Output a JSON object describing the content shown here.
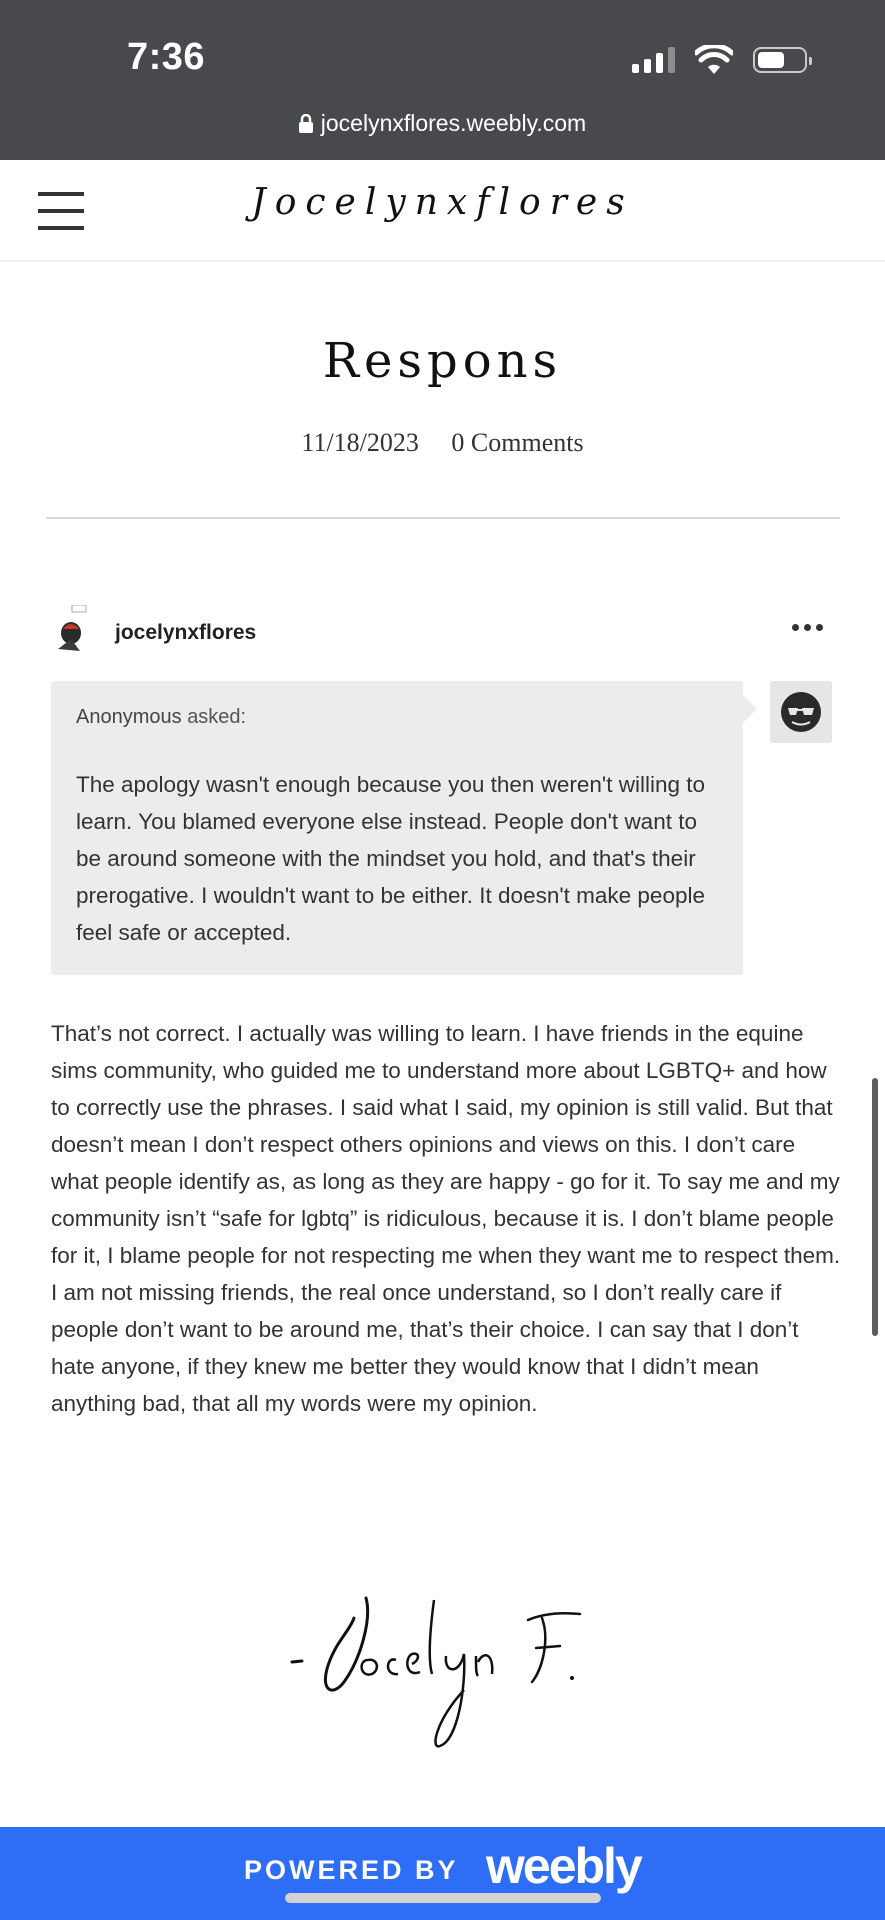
{
  "status_bar": {
    "time": "7:36"
  },
  "url_bar": {
    "url": "jocelynxflores.weebly.com"
  },
  "site": {
    "logo_text": "Jocelynxflores"
  },
  "post": {
    "title": "Respons",
    "date": "11/18/2023",
    "comments": "0 Comments"
  },
  "tumblr_post": {
    "username": "jocelynxflores",
    "asker_name": "Anonymous",
    "asker_suffix": "asked:",
    "question": "The apology wasn't enough because you then weren't willing to learn. You blamed everyone else instead. People don't want to be around someone with the mindset you hold, and that's their prerogative. I wouldn't want to be either. It doesn't make people feel safe or accepted.",
    "answer": "That’s not correct. I actually was willing to learn. I have friends in the equine sims community, who guided me to understand more about LGBTQ+ and how to correctly use the phrases. I said what I said, my opinion is still valid. But that doesn’t mean I don’t respect others opinions and views on this. I don’t care what people identify as, as long as they are happy - go for it. To say me and my community isn’t “safe for lgbtq” is ridiculous, because it is. I don’t blame people for it, I blame people for not respecting me when they want me to respect them. I am not missing friends, the real once understand, so I don’t really care if people don’t want to be around me, that’s their choice. I can say that I don’t hate anyone, if they knew me better they would know that I didn’t mean anything bad, that all my words were my opinion."
  },
  "signature": {
    "text": "- Jocelyn F."
  },
  "footer": {
    "powered_by": "POWERED BY",
    "brand": "weebly"
  },
  "colors": {
    "status_bar_bg": "#48494c",
    "footer_bg": "#2e6df5",
    "ask_box_bg": "#ececec"
  },
  "icons": [
    "lock-icon",
    "signal-icon",
    "wifi-icon",
    "battery-icon",
    "menu-icon",
    "more-icon",
    "user-avatar",
    "anonymous-avatar"
  ]
}
